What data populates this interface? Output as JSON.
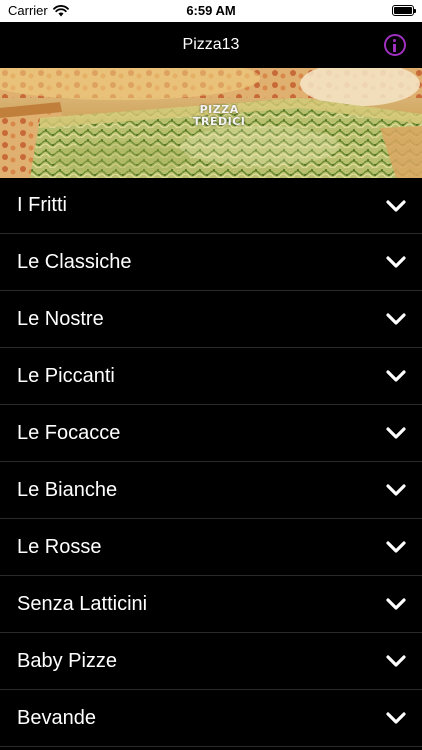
{
  "status_bar": {
    "carrier": "Carrier",
    "time": "6:59 AM",
    "wifi_icon": "wifi-icon",
    "battery_icon": "battery-icon"
  },
  "nav": {
    "title": "Pizza13",
    "info_icon": "info-icon",
    "accent_color": "#a030c0"
  },
  "hero": {
    "logo_line1": "PIZZA",
    "logo_line2": "TREDICI"
  },
  "menu": {
    "items": [
      {
        "label": "I Fritti",
        "icon": "chevron-down-icon"
      },
      {
        "label": "Le Classiche",
        "icon": "chevron-down-icon"
      },
      {
        "label": "Le Nostre",
        "icon": "chevron-down-icon"
      },
      {
        "label": "Le Piccanti",
        "icon": "chevron-down-icon"
      },
      {
        "label": "Le Focacce",
        "icon": "chevron-down-icon"
      },
      {
        "label": "Le Bianche",
        "icon": "chevron-down-icon"
      },
      {
        "label": "Le Rosse",
        "icon": "chevron-down-icon"
      },
      {
        "label": "Senza Latticini",
        "icon": "chevron-down-icon"
      },
      {
        "label": "Baby Pizze",
        "icon": "chevron-down-icon"
      },
      {
        "label": "Bevande",
        "icon": "chevron-down-icon"
      }
    ]
  }
}
